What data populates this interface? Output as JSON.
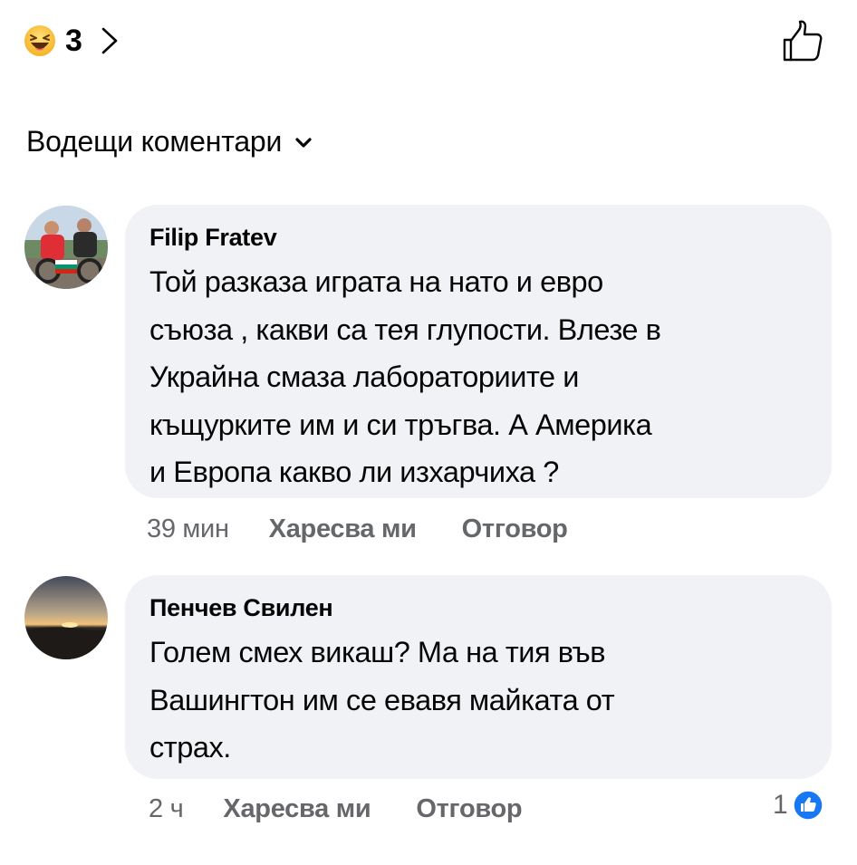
{
  "reactions": {
    "count": "3",
    "emoji_icon": "haha-emoji-icon"
  },
  "sort": {
    "label": "Водещи коментари"
  },
  "comments": [
    {
      "author": "Filip Fratev",
      "text": "Той разказа играта на нато и евро\nсъюза , какви са тея глупости. Влезе в\nУкрайна смаза лабораториите и\nкъщурките им и си тръгва. А Америка\nи Европа какво ли изхарчиха ?",
      "time": "39 мин",
      "like_label": "Харесва ми",
      "reply_label": "Отговор"
    },
    {
      "author": "Пенчев Свилен",
      "text": "Голем смех викаш? Ма на тия във\nВашингтон  им се евавя майката от\nстрах.",
      "time": "2 ч",
      "like_label": "Харесва ми",
      "reply_label": "Отговор",
      "likes": "1"
    }
  ],
  "colors": {
    "bubble_bg": "#f0f2f5",
    "meta_text": "#65676b",
    "like_blue": "#1877f2"
  }
}
